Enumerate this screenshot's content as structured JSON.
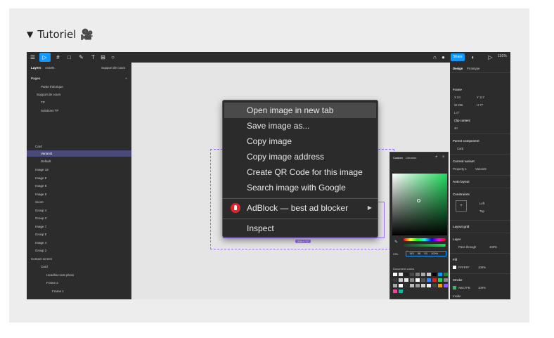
{
  "summary": {
    "arrow": "▼",
    "title": "Tutoriel",
    "emoji": "🎥"
  },
  "figma": {
    "share_label": "Share",
    "zoom": "101%",
    "left_tabs": [
      "Layers",
      "Assets"
    ],
    "left_page_label": "Support de cours",
    "pages_header": "Pages",
    "pages": [
      "Partie théorique",
      "Support de cours",
      "TP",
      "Solutions TP"
    ],
    "layers": [
      "Card",
      "Variant3",
      "Default",
      "Image 18",
      "Image 5",
      "Image 8",
      "Image 6",
      "Score",
      "Group 4",
      "Group 3",
      "Image 7",
      "Group 5",
      "Image 4",
      "Group 2",
      "Contact screen",
      "Card",
      "Headline-text-photo",
      "Frame 2",
      "Frame 1"
    ],
    "right_tabs": [
      "Design",
      "Prototype"
    ],
    "right_sections": [
      "Frame",
      "Clip content",
      "Parent component",
      "Card",
      "Current variant",
      "Property 1",
      "Variant3",
      "Auto layout",
      "Constraints",
      "Left",
      "Top",
      "Layout grid",
      "Layer",
      "Pass through",
      "100%",
      "Fill",
      "FFFFFF",
      "100%",
      "Stroke",
      "ABC7FB",
      "100%",
      "Inside"
    ],
    "frame_values": [
      "X 24",
      "Y 117",
      "W 236",
      "H 77",
      "L 0°",
      "40"
    ],
    "size_badge": "236 × 77",
    "picker_tabs": [
      "Custom",
      "Libraries"
    ],
    "picker_hex_label": "HSL",
    "picker_hex_values": [
      "183",
      "58",
      "53",
      "100%"
    ],
    "picker_doc_colors": "Document colors",
    "swatch_colors": [
      "#ffffff",
      "#e6e6e6",
      "#1e1e1e",
      "#4a4a4a",
      "#7a7a7a",
      "#aaaaaa",
      "#cccccc",
      "#000000",
      "#0d99ff",
      "#2a7e3a",
      "#3a3a3a",
      "#cfcfcf",
      "#eaeaea",
      "#888888",
      "#ffffff",
      "#555555",
      "#3b82f6",
      "#d22",
      "#1fdb5b",
      "#888",
      "#aaa",
      "#fff",
      "#333",
      "#bbb",
      "#999",
      "#ccc",
      "#eee",
      "#444",
      "#f59e0b",
      "#8b5cf6",
      "#ec4899",
      "#14b8a6"
    ]
  },
  "context_menu": {
    "items": [
      "Open image in new tab",
      "Save image as...",
      "Copy image",
      "Copy image address",
      "Create QR Code for this image",
      "Search image with Google",
      "AdBlock — best ad blocker",
      "Inspect"
    ]
  }
}
